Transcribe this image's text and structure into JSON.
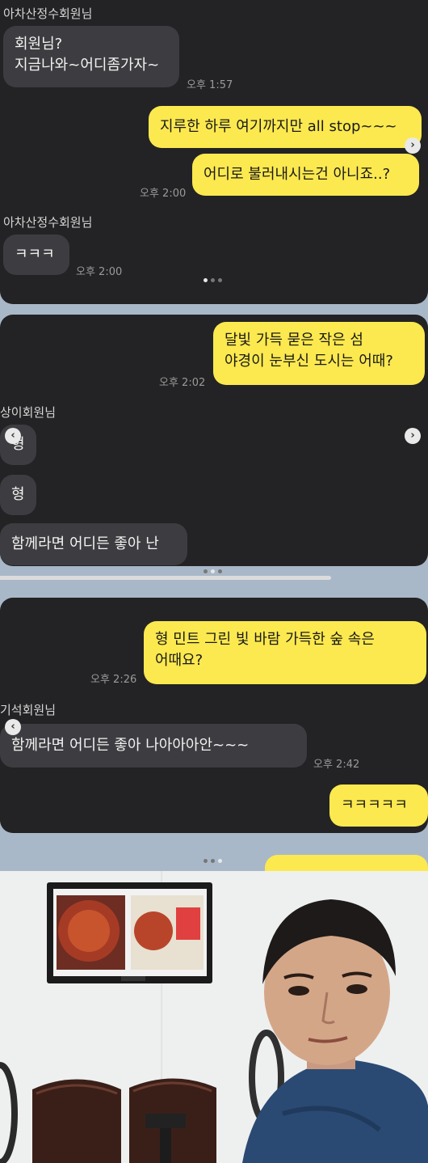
{
  "panel1": {
    "sender1": "아차산정수회원님",
    "msg1": "회원님?\n지금나와~어디좀가자~",
    "time1": "오후 1:57",
    "msg2": "지루한 하루 여기까지만 all stop~~~",
    "msg3": "어디로 불러내시는건 아니죠..?",
    "time2": "오후 2:00",
    "sender2": "아차산정수회원님",
    "msg4": "ㅋㅋㅋ",
    "time3": "오후 2:00"
  },
  "panel2": {
    "msg1": "달빛 가득 묻은 작은 섬\n야경이 눈부신 도시는 어때?",
    "time1": "오후 2:02",
    "sender": "상이회원님",
    "msg2": "형",
    "msg3": "형",
    "msg4": "함께라면 어디든 좋아 난"
  },
  "panel3": {
    "msg1": "형 민트 그린 빛 바람 가득한 숲 속은\n어때요?",
    "time1": "오후 2:26",
    "sender": "기석회원님",
    "msg2": "함께라면 어디든 좋아 나아아아안~~~",
    "time2": "오후 2:42",
    "msg3": "ㅋㅋㅋㅋㅋ"
  },
  "icons": {
    "next": "chevron-right-icon",
    "prev": "chevron-left-icon"
  },
  "colors": {
    "panel_bg": "#232325",
    "incoming_bubble": "#3d3d41",
    "outgoing_bubble": "#fce94f",
    "page_bg": "#a9b8c8"
  }
}
